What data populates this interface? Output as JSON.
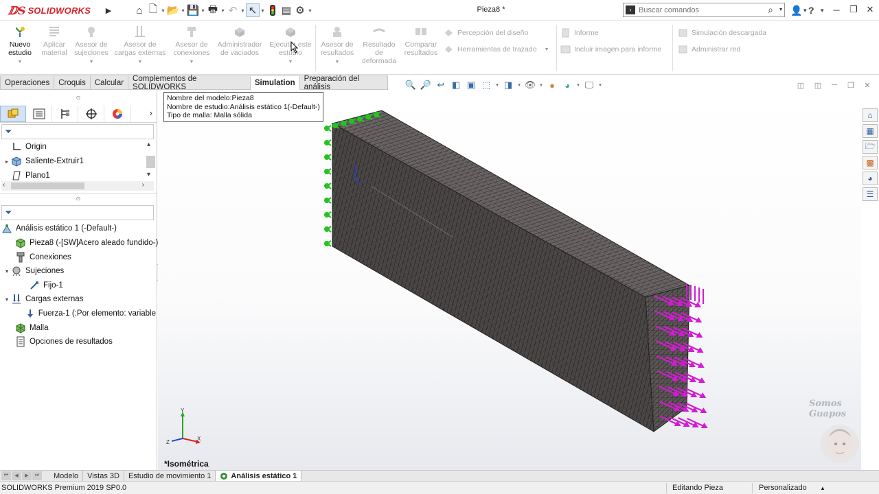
{
  "app": {
    "brand": "SOLIDWORKS",
    "document_title": "Pieza8 *"
  },
  "search": {
    "placeholder": "Buscar comandos"
  },
  "ribbon": {
    "new_study": "Nuevo estudio",
    "apply_material": "Aplicar material",
    "fixtures_advisor": "Asesor de sujeciones",
    "loads_advisor": "Asesor de cargas externas",
    "connections_advisor": "Asesor de conexiones",
    "shell_manager": "Administrador de vaciados",
    "run_study": "Ejecutar este estudio",
    "results_advisor": "Asesor de resultados",
    "deformed_result": "Resultado de deformada",
    "compare_results": "Comparar resultados",
    "design_insight": "Percepción del diseño",
    "plot_tools": "Herramientas de trazado",
    "report": "Informe",
    "include_image": "Incluir imagen para informe",
    "offloaded_sim": "Simulación descargada",
    "manage_network": "Administrar red"
  },
  "command_tabs": [
    "Operaciones",
    "Croquis",
    "Calcular",
    "Complementos de SOLIDWORKS",
    "Simulation",
    "Preparación del análisis"
  ],
  "active_command_tab": "Simulation",
  "feature_tree": [
    {
      "label": "Origin",
      "icon": "origin-icon"
    },
    {
      "label": "Saliente-Extruir1",
      "icon": "extrude-icon"
    },
    {
      "label": "Plano1",
      "icon": "plane-icon"
    }
  ],
  "study_tree": {
    "root": "Análisis estático 1 (-Default-)",
    "items": [
      {
        "label": "Pieza8 (-[SW]Acero aleado fundido-)",
        "level": 1
      },
      {
        "label": "Conexiones",
        "level": 1
      },
      {
        "label": "Sujeciones",
        "level": 1,
        "expanded": true
      },
      {
        "label": "Fijo-1",
        "level": 2
      },
      {
        "label": "Cargas externas",
        "level": 1,
        "expanded": true
      },
      {
        "label": "Fuerza-1 (:Por elemento: variable",
        "level": 2
      },
      {
        "label": "Malla",
        "level": 1
      },
      {
        "label": "Opciones de resultados",
        "level": 1
      }
    ]
  },
  "tooltip": {
    "line1": "Nombre del modelo:Pieza8",
    "line2": "Nombre de estudio:Análisis estático 1(-Default-)",
    "line3": "Tipo de malla: Malla sólida"
  },
  "viewport": {
    "view_name": "*Isométrica",
    "watermark": "Somos Guapos",
    "mesh_color": "#4a4444",
    "fixture_color": "#22c422",
    "force_color": "#d41ad4"
  },
  "bottom_tabs": [
    "Modelo",
    "Vistas 3D",
    "Estudio de movimiento 1",
    "Análisis estático 1"
  ],
  "active_bottom_tab": "Análisis estático 1",
  "status": {
    "version": "SOLIDWORKS Premium 2019 SP0.0",
    "mode": "Editando Pieza",
    "units": "Personalizado"
  }
}
